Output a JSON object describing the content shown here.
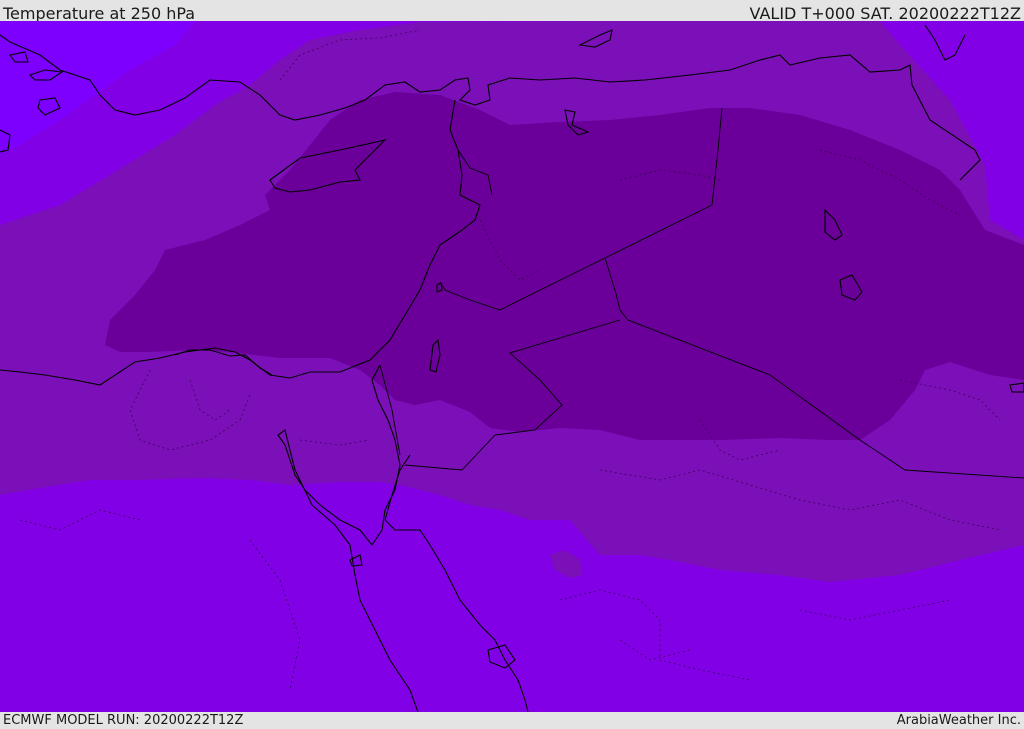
{
  "header": {
    "title": "Temperature at 250 hPa",
    "valid": "VALID T+000 SAT. 20200222T12Z"
  },
  "footer": {
    "model_run": "ECMWF MODEL RUN: 20200222T12Z",
    "credit": "ArabiaWeather Inc."
  },
  "map": {
    "field": "temperature",
    "level": "250 hPa",
    "colors": {
      "coldest": "#7d00ff",
      "cold": "#8200e6",
      "mid": "#7b10b8",
      "warm": "#6a0099",
      "coastline": "#000000"
    }
  }
}
